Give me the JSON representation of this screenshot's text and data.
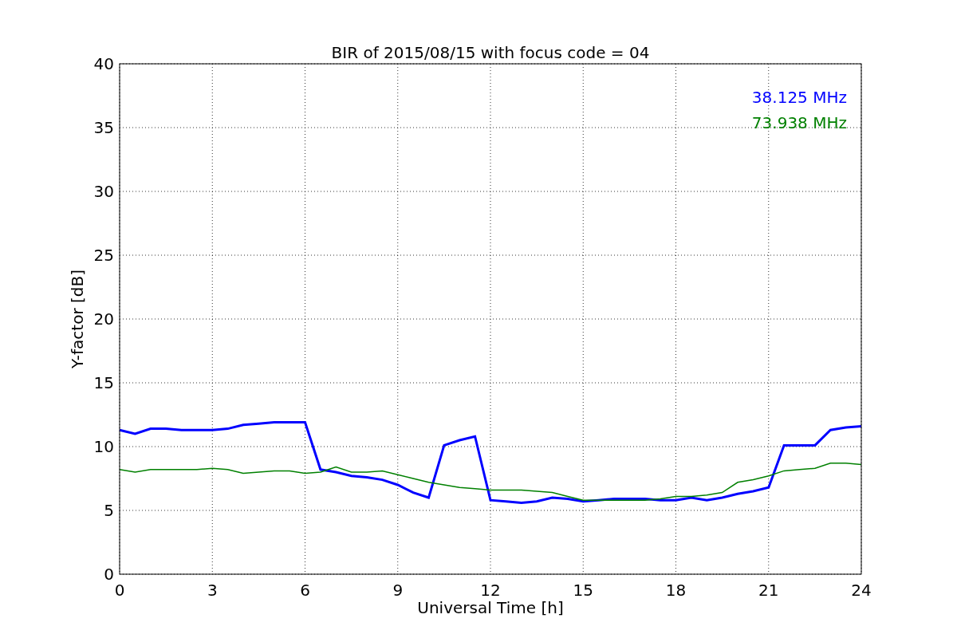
{
  "figure": {
    "chart_data": {
      "type": "line",
      "title": "BIR of 2015/08/15 with focus code = 04",
      "xlabel": "Universal Time [h]",
      "ylabel": "Y-factor [dB]",
      "x": [
        0,
        0.5,
        1,
        1.5,
        2,
        2.5,
        3,
        3.5,
        4,
        4.5,
        5,
        5.5,
        6,
        6.5,
        7,
        7.5,
        8,
        8.5,
        9,
        9.5,
        10,
        10.5,
        11,
        11.5,
        12,
        12.5,
        13,
        13.5,
        14,
        14.5,
        15,
        15.5,
        16,
        16.5,
        17,
        17.5,
        18,
        18.5,
        19,
        19.5,
        20,
        20.5,
        21,
        21.5,
        22,
        22.5,
        23,
        23.5,
        24
      ],
      "series": [
        {
          "name": "38.125 MHz",
          "color": "#0000ff",
          "values": [
            11.3,
            11,
            11.4,
            11.4,
            11.3,
            11.3,
            11.3,
            11.4,
            11.7,
            11.8,
            11.9,
            11.9,
            11.9,
            8.2,
            8.0,
            7.7,
            7.6,
            7.4,
            7.0,
            6.4,
            6.0,
            10.1,
            10.5,
            10.8,
            5.8,
            5.7,
            5.6,
            5.7,
            6.0,
            5.9,
            5.7,
            5.8,
            5.9,
            5.9,
            5.9,
            5.8,
            5.8,
            6.0,
            5.8,
            6.0,
            6.3,
            6.5,
            6.8,
            10.1,
            10.1,
            10.1,
            11.3,
            11.5,
            11.6
          ]
        },
        {
          "name": "73.938 MHz",
          "color": "#008000",
          "values": [
            8.2,
            8.0,
            8.2,
            8.2,
            8.2,
            8.2,
            8.3,
            8.2,
            7.9,
            8.0,
            8.1,
            8.1,
            7.9,
            8.0,
            8.4,
            8.0,
            8.0,
            8.1,
            7.8,
            7.5,
            7.2,
            7.0,
            6.8,
            6.7,
            6.6,
            6.6,
            6.6,
            6.5,
            6.4,
            6.1,
            5.8,
            5.8,
            5.8,
            5.8,
            5.8,
            5.9,
            6.1,
            6.1,
            6.2,
            6.4,
            7.2,
            7.4,
            7.7,
            8.1,
            8.2,
            8.3,
            8.7,
            8.7,
            8.6
          ]
        }
      ],
      "xlim": [
        0,
        24
      ],
      "ylim": [
        0,
        40
      ],
      "xticks": [
        0,
        3,
        6,
        9,
        12,
        15,
        18,
        21,
        24
      ],
      "yticks": [
        0,
        5,
        10,
        15,
        20,
        25,
        30,
        35,
        40
      ],
      "grid": true
    }
  }
}
